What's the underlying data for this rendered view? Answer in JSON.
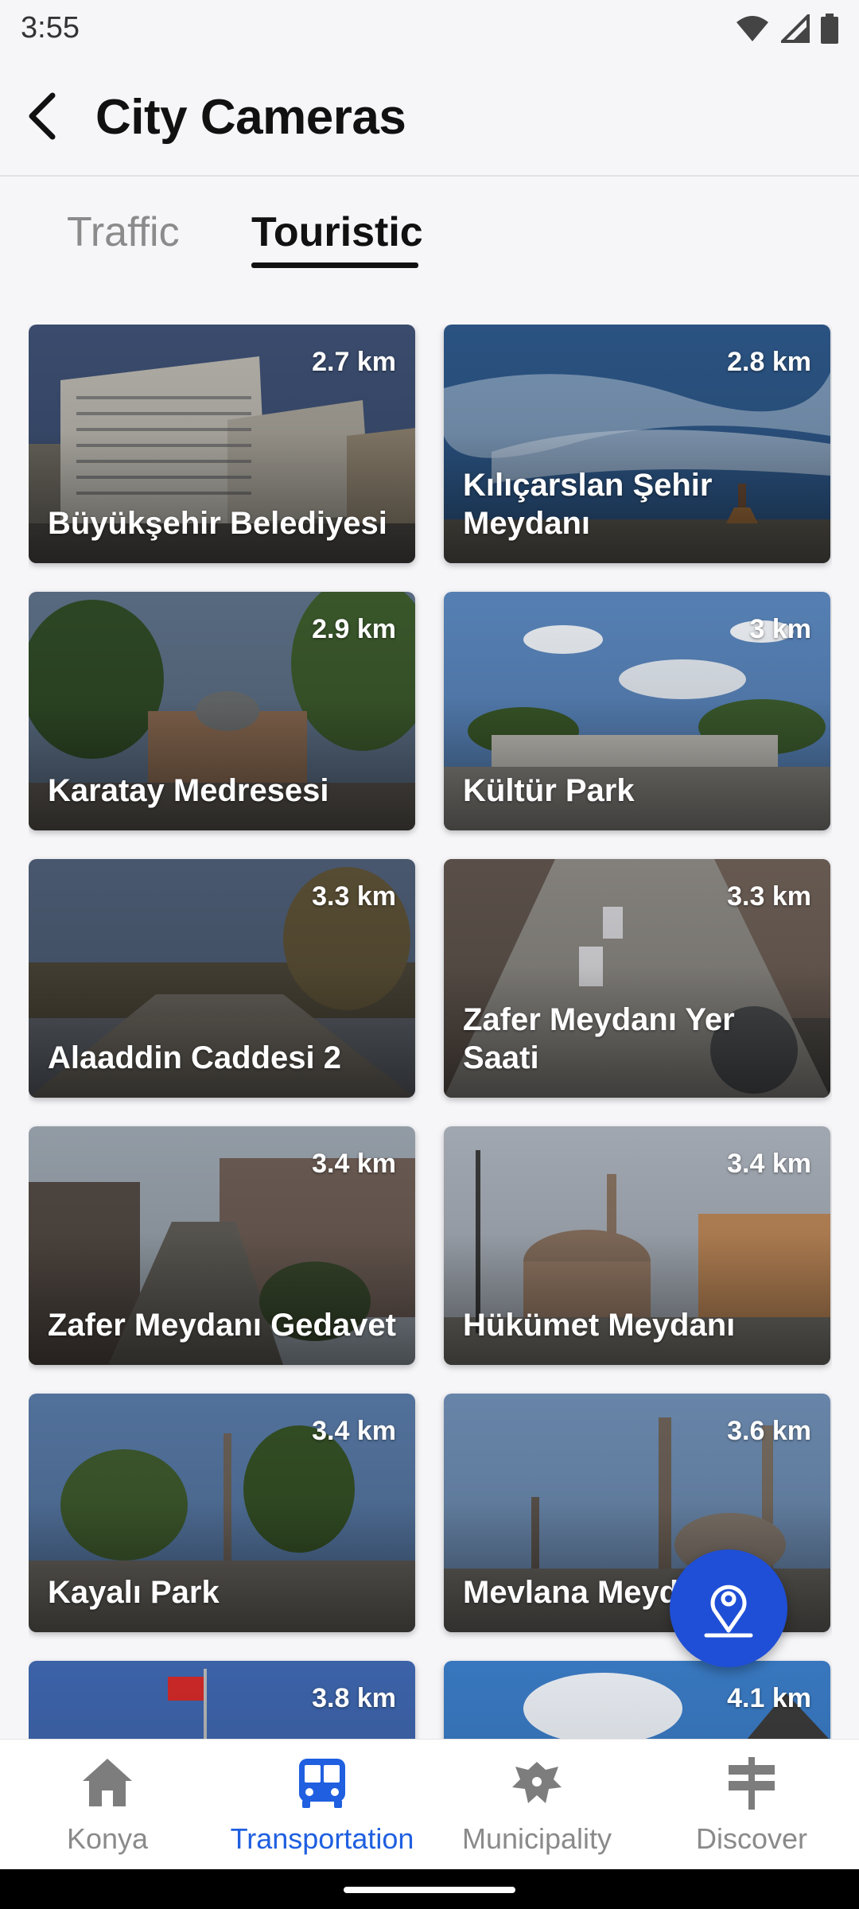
{
  "status_bar": {
    "time": "3:55",
    "icons": [
      "wifi-icon",
      "signal-icon",
      "battery-icon"
    ]
  },
  "header": {
    "title": "City Cameras",
    "back_icon": "chevron-left-icon"
  },
  "tabs": [
    {
      "label": "Traffic",
      "active": false
    },
    {
      "label": "Touristic",
      "active": true
    }
  ],
  "cameras": [
    {
      "name": "Büyükşehir Belediyesi",
      "distance": "2.7 km"
    },
    {
      "name": "Kılıçarslan Şehir Meydanı",
      "distance": "2.8 km"
    },
    {
      "name": "Karatay Medresesi",
      "distance": "2.9 km"
    },
    {
      "name": "Kültür Park",
      "distance": "3 km"
    },
    {
      "name": "Alaaddin Caddesi 2",
      "distance": "3.3 km"
    },
    {
      "name": "Zafer Meydanı Yer Saati",
      "distance": "3.3 km"
    },
    {
      "name": "Zafer Meydanı Gedavet",
      "distance": "3.4 km"
    },
    {
      "name": "Hükümet Meydanı",
      "distance": "3.4 km"
    },
    {
      "name": "Kayalı Park",
      "distance": "3.4 km"
    },
    {
      "name": "Mevlana Meydanı",
      "distance": "3.6 km"
    },
    {
      "name": "",
      "distance": "3.8 km"
    },
    {
      "name": "",
      "distance": "4.1 km"
    }
  ],
  "fab": {
    "icon": "map-pin-icon"
  },
  "bottom_nav": [
    {
      "label": "Konya",
      "icon": "home-icon",
      "active": false
    },
    {
      "label": "Transportation",
      "icon": "bus-icon",
      "active": true
    },
    {
      "label": "Municipality",
      "icon": "emblem-icon",
      "active": false
    },
    {
      "label": "Discover",
      "icon": "signpost-icon",
      "active": false
    }
  ],
  "colors": {
    "accent": "#1f4fd6",
    "active_nav": "#1f5fe0",
    "inactive": "#8a8a8a"
  }
}
